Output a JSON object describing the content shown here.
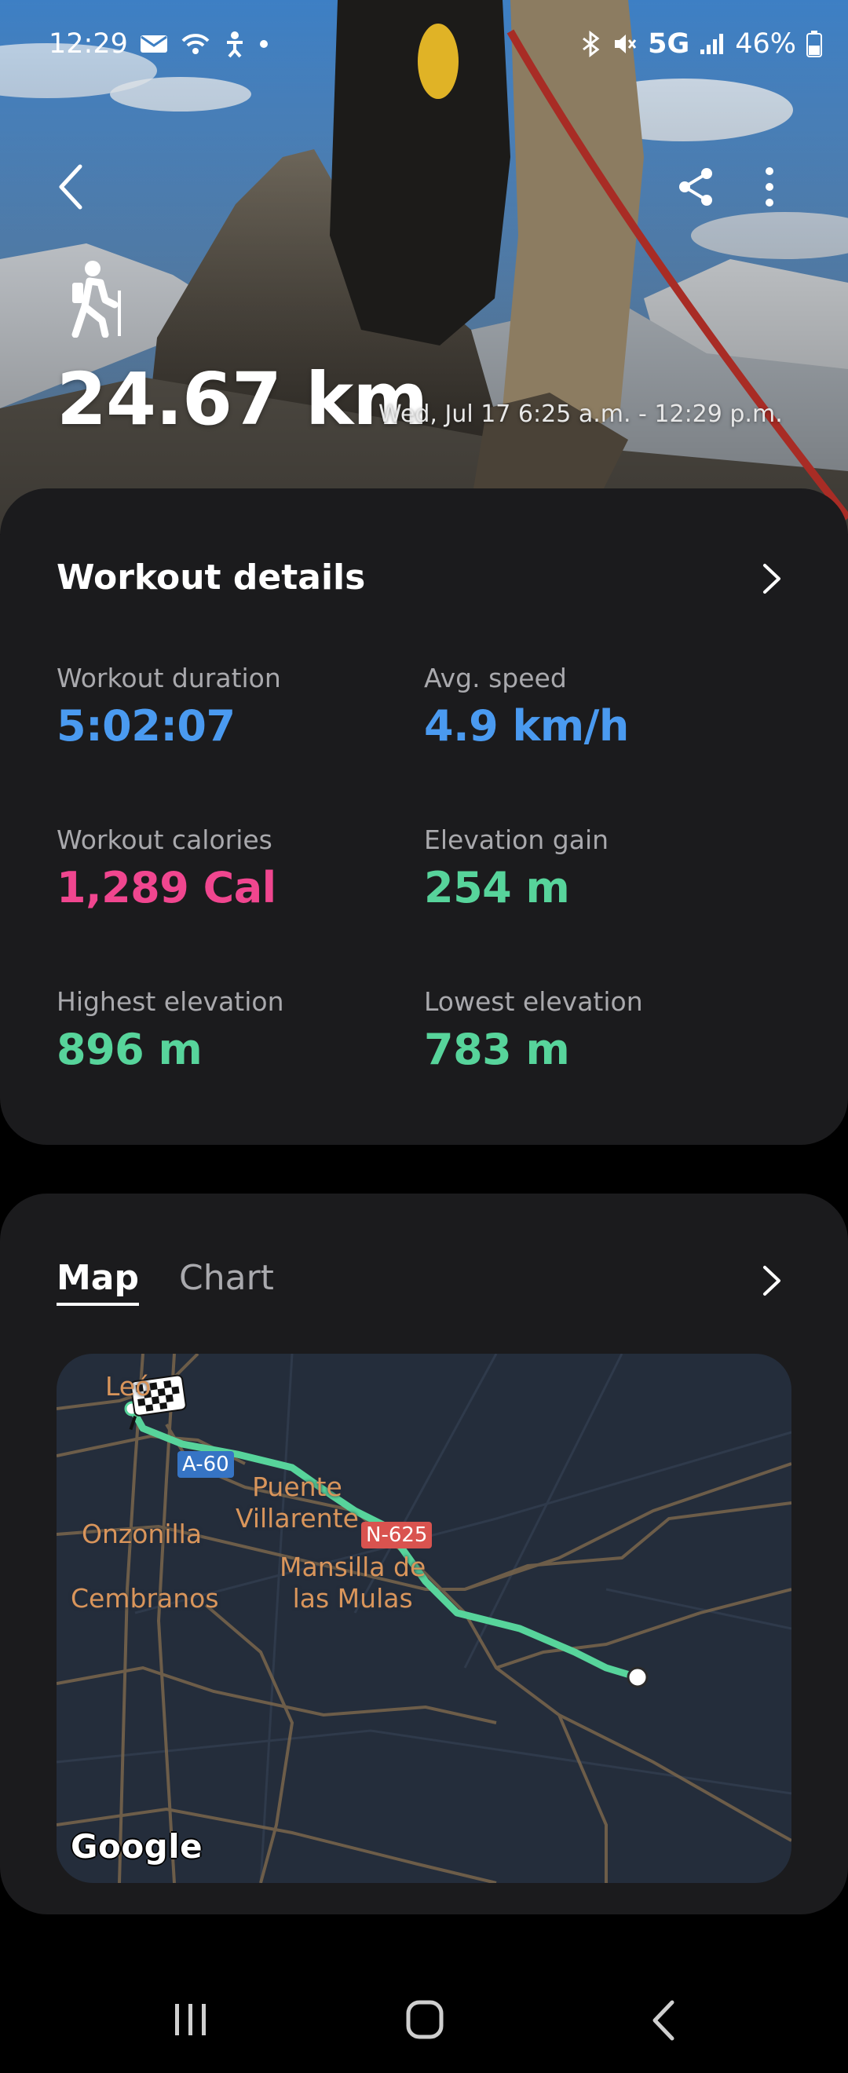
{
  "status_bar": {
    "time": "12:29",
    "network": "5G",
    "battery": "46%"
  },
  "header": {
    "activity_icon": "hiking-icon",
    "distance": "24.67 km",
    "date_range": "Wed, Jul 17 6:25 a.m. - 12:29 p.m."
  },
  "workout_details": {
    "title": "Workout details",
    "metrics": [
      {
        "label": "Workout duration",
        "value": "5:02:07",
        "color": "#4a9af0"
      },
      {
        "label": "Avg. speed",
        "value": "4.9 km/h",
        "color": "#4a9af0"
      },
      {
        "label": "Workout calories",
        "value": "1,289 Cal",
        "color": "#f0468f"
      },
      {
        "label": "Elevation gain",
        "value": "254 m",
        "color": "#57d49b"
      },
      {
        "label": "Highest elevation",
        "value": "896 m",
        "color": "#57d49b"
      },
      {
        "label": "Lowest elevation",
        "value": "783 m",
        "color": "#57d49b"
      }
    ]
  },
  "map_card": {
    "tabs": [
      {
        "label": "Map",
        "active": true
      },
      {
        "label": "Chart",
        "active": false
      }
    ],
    "places": {
      "leon": "Leó",
      "puente": "Puente\nVillarente",
      "onzonilla": "Onzonilla",
      "mansilla": "Mansilla de\nlas Mulas",
      "cembranos": "Cembranos"
    },
    "roads": {
      "a60": "A-60",
      "n625": "N-625"
    },
    "attribution": "Google",
    "route_color": "#57d49b"
  }
}
